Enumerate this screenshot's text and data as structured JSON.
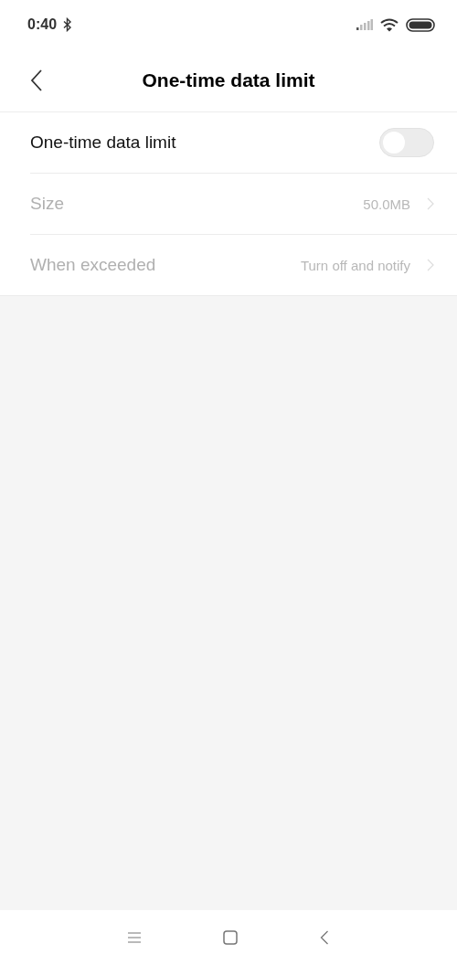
{
  "status_bar": {
    "time": "0:40"
  },
  "header": {
    "title": "One-time data limit"
  },
  "settings": [
    {
      "kind": "switch",
      "label": "One-time data limit",
      "on": false,
      "disabled": false
    },
    {
      "kind": "link",
      "label": "Size",
      "value": "50.0MB",
      "disabled": true
    },
    {
      "kind": "link",
      "label": "When exceeded",
      "value": "Turn off and notify",
      "disabled": true
    }
  ]
}
